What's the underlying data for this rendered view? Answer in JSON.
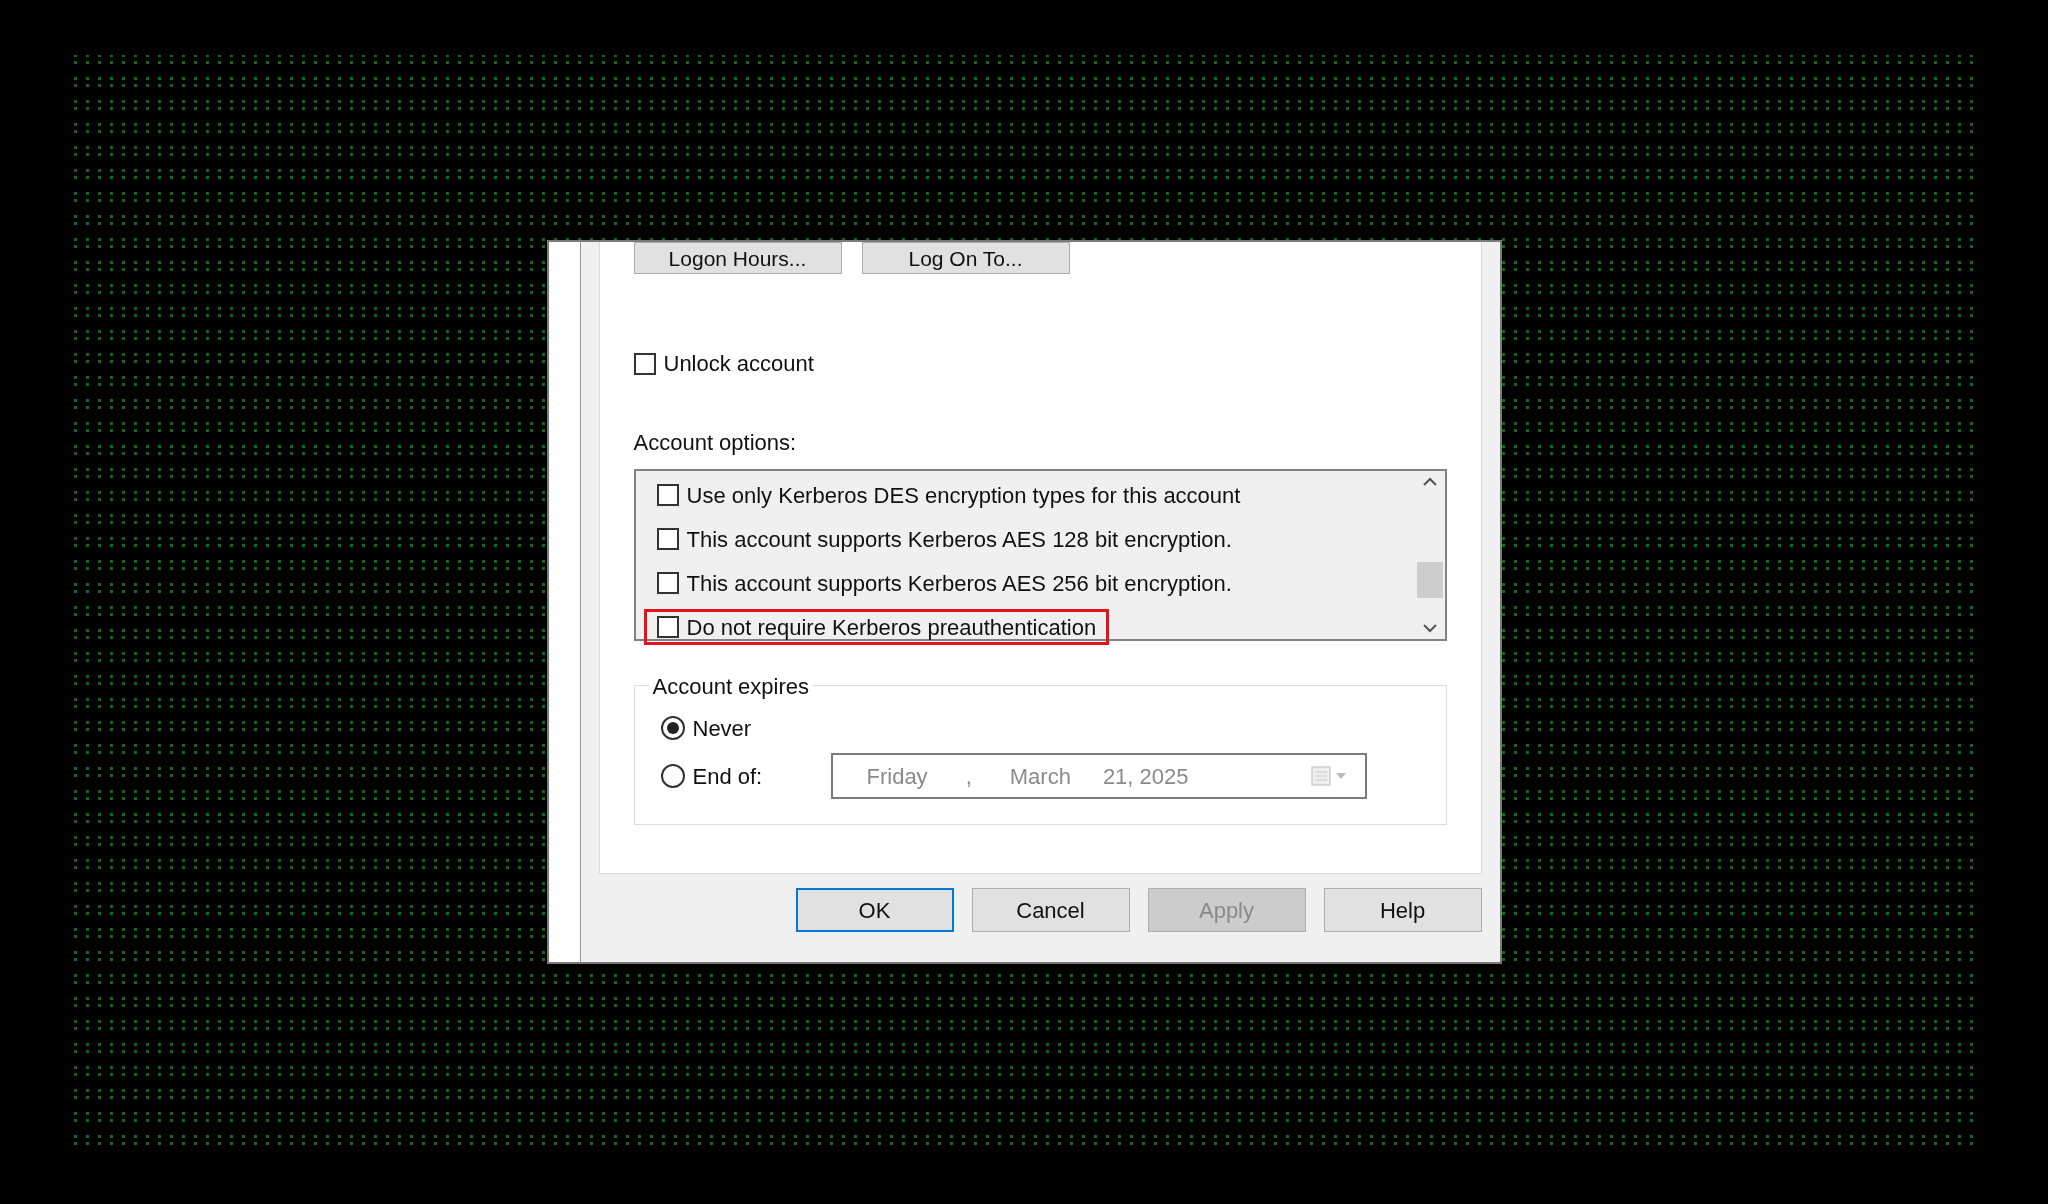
{
  "top_buttons": [
    {
      "label": "Logon Hours..."
    },
    {
      "label": "Log On To..."
    }
  ],
  "unlock": {
    "label": "Unlock account",
    "checked": false
  },
  "account_options": {
    "label": "Account options:",
    "items": [
      {
        "label": "Use only Kerberos DES encryption types for this account",
        "checked": false,
        "highlighted": false
      },
      {
        "label": "This account supports Kerberos AES 128 bit encryption.",
        "checked": false,
        "highlighted": false
      },
      {
        "label": "This account supports Kerberos AES 256 bit encryption.",
        "checked": false,
        "highlighted": false
      },
      {
        "label": "Do not require Kerberos preauthentication",
        "checked": false,
        "highlighted": true
      }
    ]
  },
  "account_expires": {
    "label": "Account expires",
    "options": [
      {
        "label": "Never",
        "selected": true
      },
      {
        "label": "End of:",
        "selected": false
      }
    ],
    "date": {
      "weekday": "Friday",
      "separator": ",",
      "month": "March",
      "day_year": "21, 2025",
      "disabled": true
    }
  },
  "buttons": [
    {
      "label": "OK",
      "default": true,
      "disabled": false
    },
    {
      "label": "Cancel",
      "default": false,
      "disabled": false
    },
    {
      "label": "Apply",
      "default": false,
      "disabled": true
    },
    {
      "label": "Help",
      "default": false,
      "disabled": false
    }
  ]
}
